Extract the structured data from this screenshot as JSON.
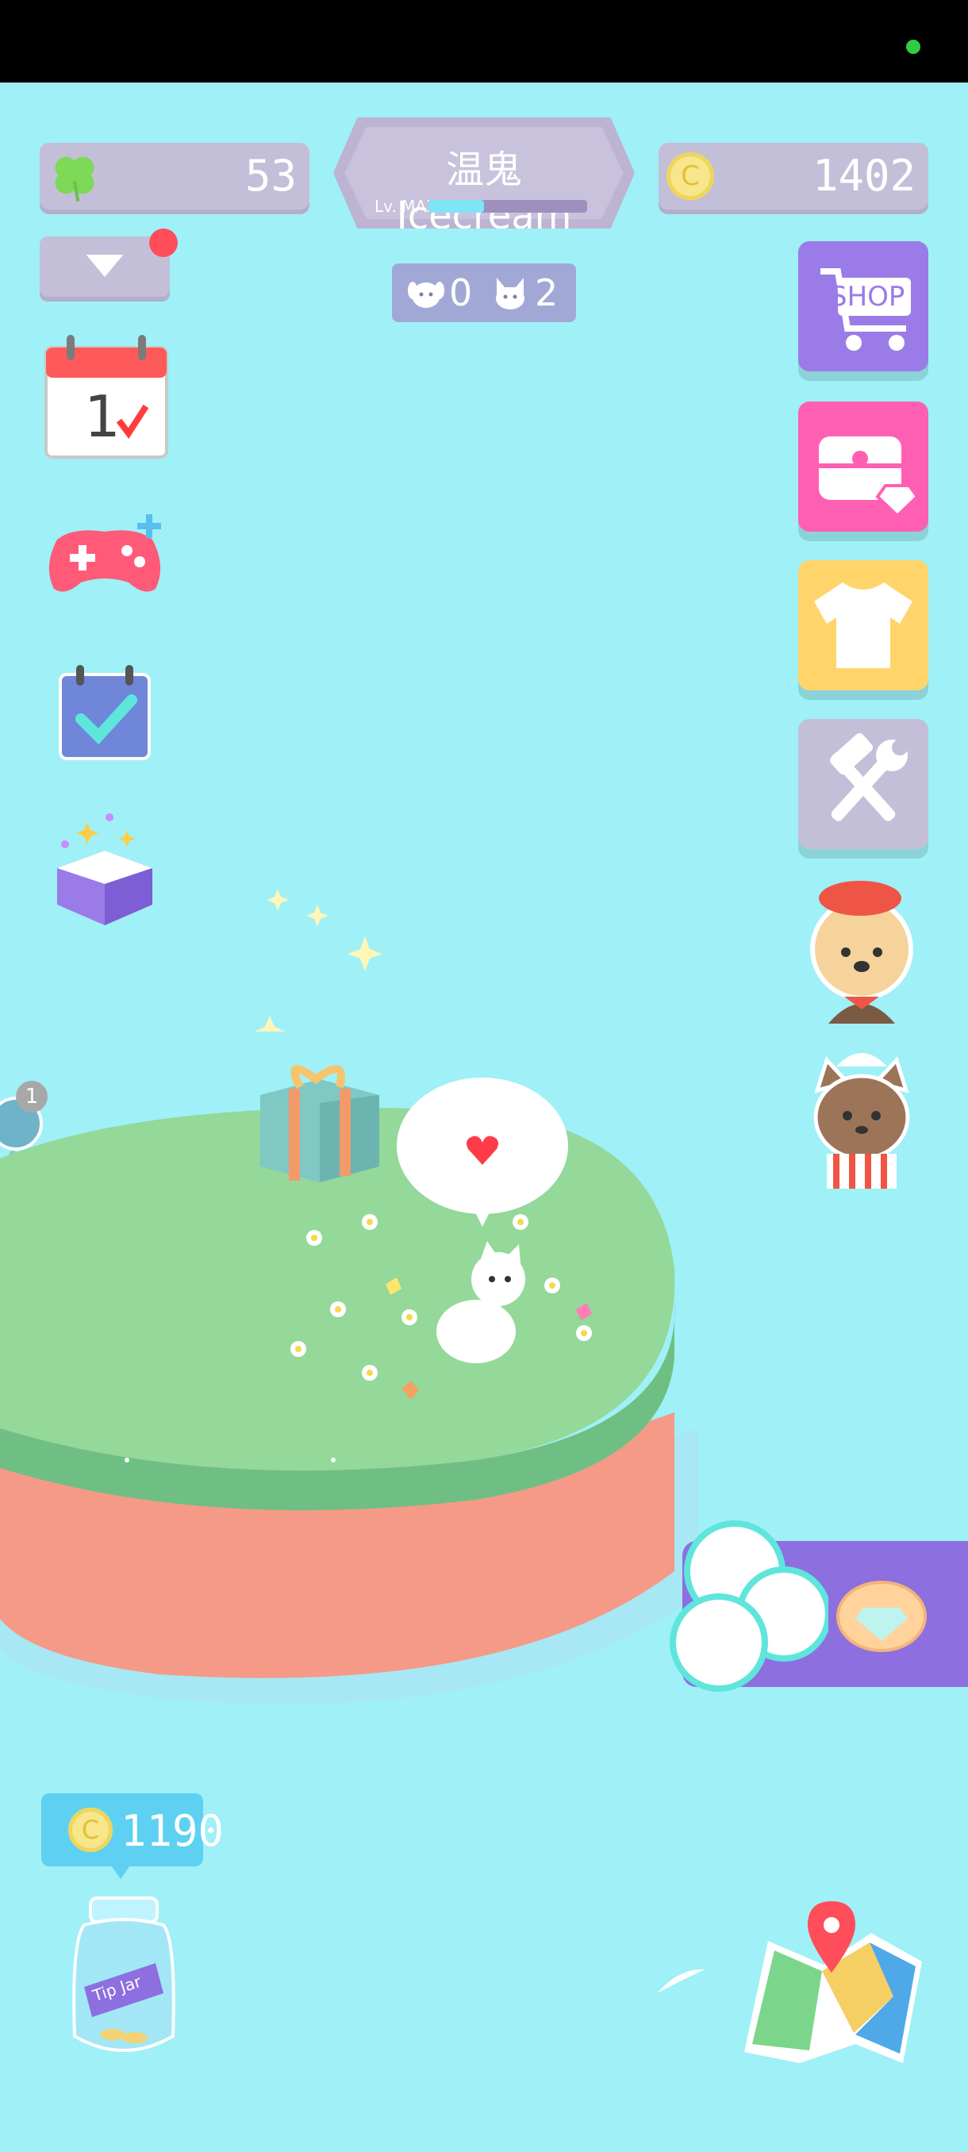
{
  "top_bar": {
    "clover_count": "53",
    "coin_count": "1402",
    "player_name": "温鬼 Icecream",
    "level_label": "Lv. MAX",
    "level_progress": 0.35
  },
  "pets": {
    "dogs": "0",
    "cats": "2"
  },
  "left_panel": {
    "badge_count": "1"
  },
  "right_panel": {
    "shop_label": "SHOP"
  },
  "tip_jar": {
    "amount": "1190",
    "jar_label": "Tip Jar"
  },
  "colors": {
    "background": "#9ff0f7",
    "shop": "#9b7be8",
    "chest": "#ff5fb3",
    "outfit": "#ffd56b",
    "tools": "#c4bfd8",
    "banner": "#8d6fe0"
  }
}
